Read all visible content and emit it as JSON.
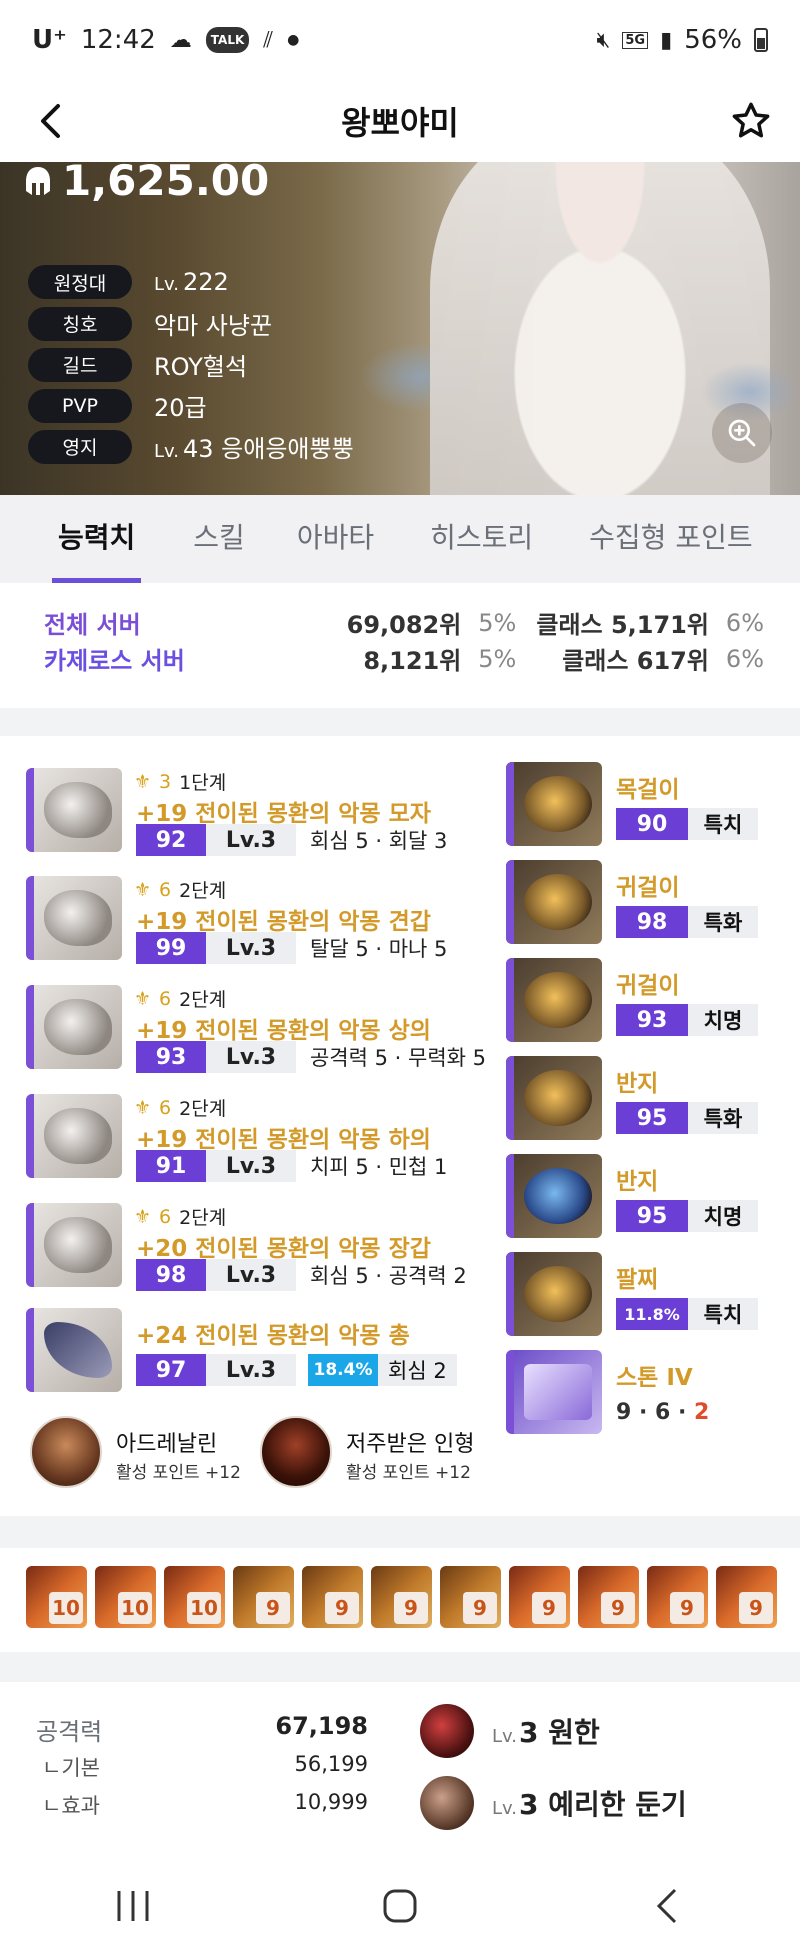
{
  "status": {
    "carrier": "U⁺",
    "time": "12:42",
    "battery": "56%",
    "network": "5G"
  },
  "header": {
    "title": "왕뽀야미"
  },
  "hero": {
    "score": "1,625.00",
    "rows": [
      {
        "label": "원정대",
        "lv": "Lv.",
        "value": "222"
      },
      {
        "label": "칭호",
        "lv": "",
        "value": "악마 사냥꾼"
      },
      {
        "label": "길드",
        "lv": "",
        "value": "ROY혈석"
      },
      {
        "label": "PVP",
        "lv": "",
        "value": "20급"
      },
      {
        "label": "영지",
        "lv": "Lv.",
        "value": "43 응애응애뿡뿡"
      }
    ]
  },
  "tabs": [
    "능력치",
    "스킬",
    "아바타",
    "히스토리",
    "수집형 포인트"
  ],
  "ranking": [
    {
      "server": "전체 서버",
      "rank": "69,082위",
      "pct": "5%",
      "class_rank": "클래스 5,171위",
      "class_pct": "6%",
      "color": "#7a4fd6"
    },
    {
      "server": "카제로스 서버",
      "rank": "8,121위",
      "pct": "5%",
      "class_rank": "클래스 617위",
      "class_pct": "6%",
      "color": "#7a4fd6"
    }
  ],
  "equipment": [
    {
      "icon": "hat-icon",
      "tier": "3",
      "stage": "1단계",
      "name": "+19 전이된 몽환의 악몽 모자",
      "quality": "92",
      "lv": "Lv.3",
      "option": "회심 5 · 회달 3"
    },
    {
      "icon": "shoulder-icon",
      "tier": "6",
      "stage": "2단계",
      "name": "+19 전이된 몽환의 악몽 견갑",
      "quality": "99",
      "lv": "Lv.3",
      "option": "탈달 5 · 마나 5"
    },
    {
      "icon": "chest-icon",
      "tier": "6",
      "stage": "2단계",
      "name": "+19 전이된 몽환의 악몽 상의",
      "quality": "93",
      "lv": "Lv.3",
      "option": "공격력 5 · 무력화 5"
    },
    {
      "icon": "pants-icon",
      "tier": "6",
      "stage": "2단계",
      "name": "+19 전이된 몽환의 악몽 하의",
      "quality": "91",
      "lv": "Lv.3",
      "option": "치피 5 · 민첩 1"
    },
    {
      "icon": "gloves-icon",
      "tier": "6",
      "stage": "2단계",
      "name": "+20 전이된 몽환의 악몽 장갑",
      "quality": "98",
      "lv": "Lv.3",
      "option": "회심 5 · 공격력 2"
    }
  ],
  "weapon": {
    "icon": "gun-icon",
    "name": "+24 전이된 몽환의 악몽 총",
    "quality": "97",
    "lv": "Lv.3",
    "elixir": "18.4%",
    "option": "회심 2"
  },
  "accessories": [
    {
      "icon": "necklace-icon",
      "name": "목걸이",
      "quality": "90",
      "effect": "특치"
    },
    {
      "icon": "earring-icon",
      "name": "귀걸이",
      "quality": "98",
      "effect": "특화"
    },
    {
      "icon": "earring-icon",
      "name": "귀걸이",
      "quality": "93",
      "effect": "치명"
    },
    {
      "icon": "ring-icon",
      "name": "반지",
      "quality": "95",
      "effect": "특화"
    },
    {
      "icon": "ring-icon",
      "name": "반지",
      "quality": "95",
      "effect": "치명"
    },
    {
      "icon": "bracelet-icon",
      "name": "팔찌",
      "quality": "11.8%",
      "effect": "특치"
    }
  ],
  "stone": {
    "name": "스톤 IV",
    "v1": "9",
    "v2": "6",
    "v3": "2"
  },
  "engravings": [
    {
      "name": "아드레날린",
      "points": "활성 포인트 +12"
    },
    {
      "name": "저주받은 인형",
      "points": "활성 포인트 +12"
    }
  ],
  "gems": [
    "10",
    "10",
    "10",
    "9",
    "9",
    "9",
    "9",
    "9",
    "9",
    "9",
    "9"
  ],
  "stats": {
    "attack_label": "공격력",
    "attack": "67,198",
    "base_label": "ㄴ기본",
    "base": "56,199",
    "effect_label": "ㄴ효과",
    "effect": "10,999"
  },
  "cards": [
    {
      "lv": "Lv.",
      "name": "3 원한"
    },
    {
      "lv": "Lv.",
      "name": "3 예리한 둔기"
    }
  ]
}
